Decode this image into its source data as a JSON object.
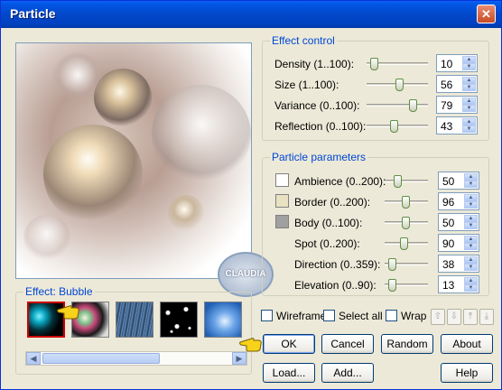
{
  "window": {
    "title": "Particle",
    "close_label": "✕"
  },
  "watermark": "CLAUDIA",
  "effect_control": {
    "legend": "Effect control",
    "rows": [
      {
        "label": "Density (1..100):",
        "value": "10"
      },
      {
        "label": "Size (1..100):",
        "value": "56"
      },
      {
        "label": "Variance (0..100):",
        "value": "79"
      },
      {
        "label": "Reflection (0..100):",
        "value": "43"
      }
    ]
  },
  "particle_parameters": {
    "legend": "Particle parameters",
    "rows": [
      {
        "label": "Ambience (0..200):",
        "value": "50",
        "swatch": "#ffffff"
      },
      {
        "label": "Border (0..200):",
        "value": "96",
        "swatch": "#e8e2c2"
      },
      {
        "label": "Body (0..100):",
        "value": "50",
        "swatch": "#a0a0a0"
      },
      {
        "label": "Spot (0..200):",
        "value": "90"
      },
      {
        "label": "Direction (0..359):",
        "value": "38"
      },
      {
        "label": "Elevation (0..90):",
        "value": "13"
      }
    ]
  },
  "effect_group": {
    "legend": "Effect: Bubble"
  },
  "options": {
    "wireframe": "Wireframe",
    "select_all": "Select all",
    "wrap": "Wrap"
  },
  "buttons": {
    "ok": "OK",
    "cancel": "Cancel",
    "random": "Random",
    "about": "About",
    "load": "Load...",
    "add": "Add...",
    "help": "Help"
  },
  "icons": {
    "arrow_up": "⇧",
    "arrow_down": "⇩",
    "arrow_top": "⤒",
    "arrow_bottom": "⤓",
    "scroll_left": "◀",
    "scroll_right": "▶"
  }
}
